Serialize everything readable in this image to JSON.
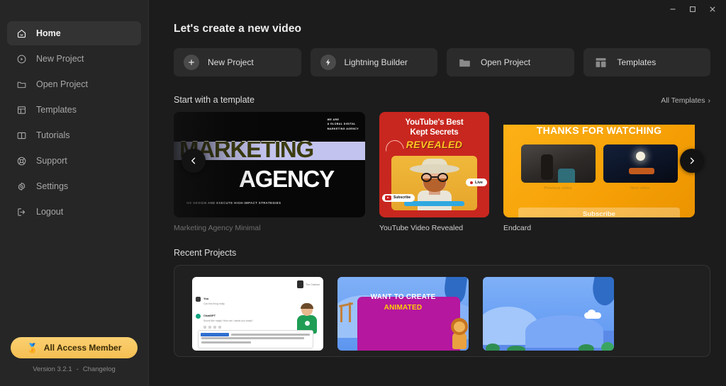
{
  "window": {
    "minimize_label": "–",
    "maximize_label": "□",
    "close_label": "✕"
  },
  "sidebar": {
    "items": [
      {
        "label": "Home",
        "icon": "home-icon",
        "active": true
      },
      {
        "label": "New Project",
        "icon": "play-circle-icon",
        "active": false
      },
      {
        "label": "Open Project",
        "icon": "folder-icon",
        "active": false
      },
      {
        "label": "Templates",
        "icon": "layout-icon",
        "active": false
      },
      {
        "label": "Tutorials",
        "icon": "book-icon",
        "active": false
      },
      {
        "label": "Support",
        "icon": "lifebuoy-icon",
        "active": false
      },
      {
        "label": "Settings",
        "icon": "gear-icon",
        "active": false
      },
      {
        "label": "Logout",
        "icon": "logout-icon",
        "active": false
      }
    ],
    "member_badge": {
      "label": "All Access Member",
      "icon": "medal-icon",
      "color": "#f5bf52"
    },
    "version": "Version 3.2.1",
    "version_separator": "-",
    "changelog_label": "Changelog"
  },
  "main": {
    "page_title": "Let's create a new video",
    "actions": [
      {
        "label": "New Project",
        "icon": "plus-circle-icon"
      },
      {
        "label": "Lightning Builder",
        "icon": "lightning-circle-icon"
      },
      {
        "label": "Open Project",
        "icon": "folder-icon"
      },
      {
        "label": "Templates",
        "icon": "layout-icon"
      }
    ],
    "templates_section": {
      "title": "Start with a template",
      "link_label": "All Templates",
      "link_chevron": "›",
      "prev_arrow": "‹",
      "next_arrow": "›",
      "items": [
        {
          "caption": "Marketing Agency Minimal",
          "corner_line1": "WE ARE",
          "corner_line2": "A GLOBAL DIGITAL",
          "corner_line3": "MARKETING AGENCY",
          "word1": "MARKETING",
          "word2": "AGENCY",
          "subtitle": "WE DESIGN AND EXECUTE HIGH-IMPACT STRATEGIES",
          "band_color": "#c3c3ef"
        },
        {
          "caption": "YouTube Video Revealed",
          "title_line1": "YouTube's Best",
          "title_line2": "Kept Secrets",
          "accent_word": "REVEALED",
          "subscribe_label": "Subscribe",
          "live_label": "Live",
          "bg_color": "#c8271f",
          "accent_color": "#ffc423"
        },
        {
          "caption": "Endcard",
          "title": "THANKS FOR WATCHING",
          "video1_label": "Previous video",
          "video2_label": "Next video",
          "subscribe_label": "Subscribe",
          "bg_color": "#f5a70a"
        }
      ]
    },
    "recent_section": {
      "title": "Recent Projects",
      "projects": [
        {
          "type": "chat-mock",
          "sender1": "You",
          "message1": "Can this thing really",
          "sender2": "ChatGPT",
          "message2": "Sound like magic! How can I assist you today?"
        },
        {
          "type": "animated-promo",
          "line1": "WANT TO CREATE",
          "line2": "ANIMATED"
        },
        {
          "type": "landscape-scene"
        }
      ]
    }
  }
}
